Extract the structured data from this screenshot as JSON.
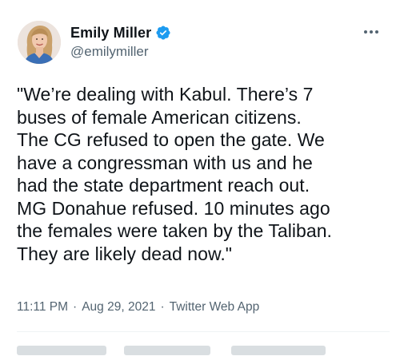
{
  "author": {
    "display_name": "Emily Miller",
    "handle": "@emilymiller",
    "verified": true
  },
  "tweet": {
    "text": "\"We’re dealing with Kabul. There’s 7\nbuses of female American citizens.\nThe CG refused to open the gate. We\nhave a congressman with us and he\nhad the state department reach out.\nMG Donahue refused. 10 minutes ago\nthe females were taken by the Taliban.\nThey are likely dead now.\"",
    "time": "11:11 PM",
    "date": "Aug 29, 2021",
    "separator": "·",
    "source": "Twitter Web App"
  },
  "icons": {
    "verified": "verified-badge-icon",
    "more": "more-horizontal-icon"
  },
  "colors": {
    "text": "#0f1419",
    "secondary": "#536471",
    "verified": "#1d9bf0",
    "divider": "#eff3f4"
  }
}
